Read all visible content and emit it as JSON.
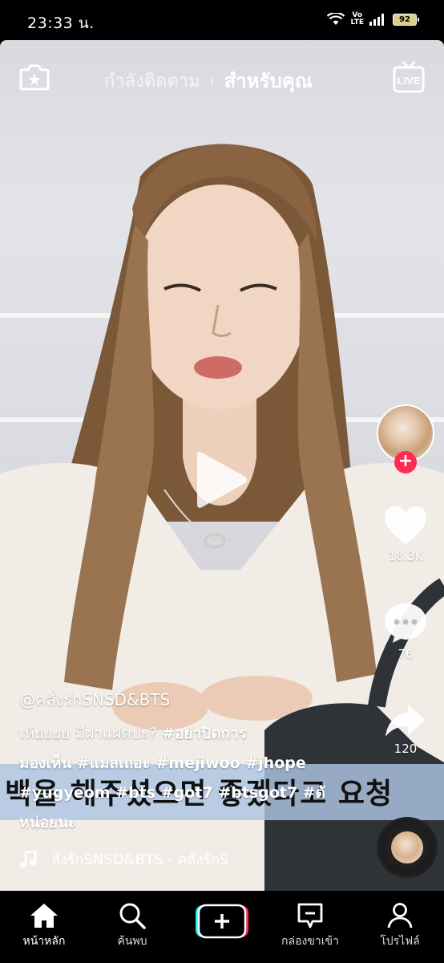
{
  "status_bar": {
    "time": "23:33 น.",
    "volte": "Vo LTE",
    "battery": "92"
  },
  "top_nav": {
    "following": "กำลังติดตาม",
    "for_you": "สำหรับคุณ",
    "live": "LIVE"
  },
  "video": {
    "subtitle_korean": "백을 해주셨으면 좋겠다고 요청"
  },
  "sidebar": {
    "likes": "18.3K",
    "comments": "76",
    "shares": "120",
    "follow_plus": "+"
  },
  "caption": {
    "username": "@คลั่งรักSNSD&BTS",
    "text_plain": "เห้ยยยย มีฝาแฝดปะ? ",
    "tags_line1": "#อย่าปิดการ",
    "tags_line2": "มองเห็น #แมสเถอะ #mejiwoo #jhope",
    "tags_line3": "#yugyeom #bts #got7 #btsgot7 #ดั",
    "tags_line4": "หน่อยนะ"
  },
  "music": {
    "title": "ลั่งรักSNSD&BTS - คลั่งรักS"
  },
  "bottom_nav": {
    "home": "หน้าหลัก",
    "discover": "ค้นพบ",
    "inbox": "กล่องขาเข้า",
    "profile": "โปรไฟล์"
  }
}
